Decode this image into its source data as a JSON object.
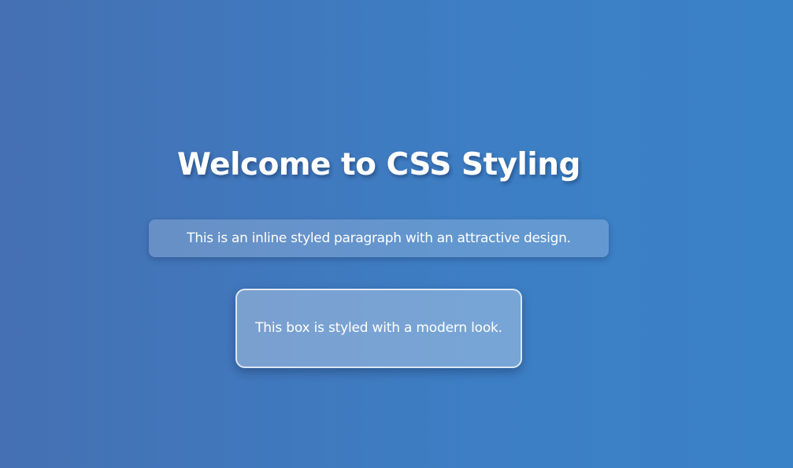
{
  "heading": {
    "text": "Welcome to CSS Styling"
  },
  "inline_paragraph": {
    "text": "This is an inline styled paragraph with an attractive design."
  },
  "styled_box": {
    "text": "This box is styled with a modern look."
  },
  "colors": {
    "background_start": "#4570b3",
    "background_end": "#3a82c8",
    "text": "#ffffff"
  }
}
